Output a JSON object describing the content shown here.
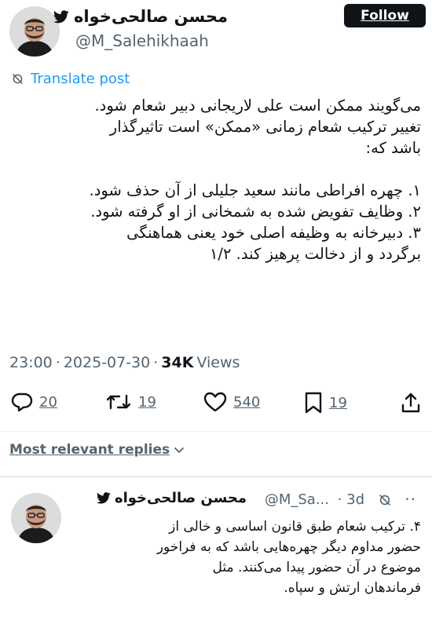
{
  "tweet": {
    "author": {
      "display_name": "محسن صالحی‌خواه",
      "handle": "@M_Salehikhaah"
    },
    "follow_label": "Follow",
    "translate_label": "Translate post",
    "body_lines": [
      "می‌گویند ممکن است علی لاریجانی دبیر شعام شود.",
      "تغییر ترکیب شعام زمانی «ممکن» است تاثیرگذار",
      "باشد که:",
      "",
      "۱. چهره افراطی مانند سعید جلیلی از آن حذف شود.",
      "۲. وظایف تفویض شده به شمخانی از او گرفته شود.",
      "۳. دبیرخانه به وظیفه اصلی خود یعنی هماهنگی",
      "برگردد و از دخالت پرهیز کند. ۱/۲"
    ],
    "time": "23:00",
    "separator": "·",
    "date": "2025-07-30",
    "views_count": "34K",
    "views_label": "Views",
    "actions": {
      "replies": "20",
      "reposts": "19",
      "likes": "540",
      "bookmarks": "19"
    }
  },
  "replies_sort_label": "Most relevant replies",
  "reply": {
    "display_name": "محسن صالحی‌خواه",
    "handle": "@M_Sa...",
    "time": "· 3d",
    "more": "··",
    "body_lines": [
      "۴. ترکیب شعام طبق قانون اساسی و خالی از",
      "حضور مداوم دیگر چهره‌هایی باشد که به فراخور",
      "موضوع در آن حضور پیدا می‌کنند. مثل",
      "فرماندهان ارتش و سپاه."
    ]
  },
  "icons": {
    "verified": "twitter-bird-icon",
    "translate": "globe-icon",
    "reply": "speech-bubble-icon",
    "repost": "repost-arrows-icon",
    "like": "heart-icon",
    "bookmark": "bookmark-icon",
    "share": "share-icon",
    "sort": "chevron-down-icon",
    "grok": "grok-icon"
  },
  "colors": {
    "accent": "#1d9bf0",
    "text": "#0f1419",
    "muted": "#536471",
    "follow_bg": "#0f1419"
  }
}
